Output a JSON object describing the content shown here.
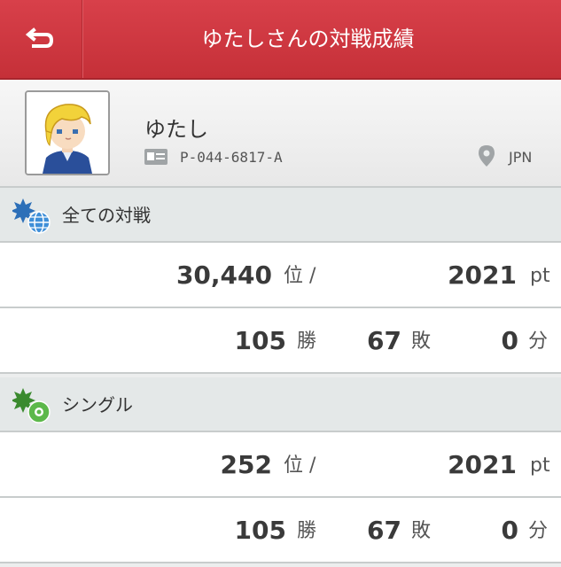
{
  "header": {
    "title": "ゆたしさんの対戦成績",
    "back_icon": "back-arrow-icon"
  },
  "profile": {
    "name": "ゆたし",
    "player_id": "P-044-6817-A",
    "region": "JPN"
  },
  "sections": [
    {
      "label": "全ての対戦",
      "icon": "globe-burst-icon",
      "rank": "30,440",
      "rank_unit": "位 /",
      "rating": "2021",
      "rating_unit": "pt",
      "wins": "105",
      "wins_unit": "勝",
      "losses": "67",
      "losses_unit": "敗",
      "draws": "0",
      "draws_unit": "分"
    },
    {
      "label": "シングル",
      "icon": "single-battle-icon",
      "rank": "252",
      "rank_unit": "位 /",
      "rating": "2021",
      "rating_unit": "pt",
      "wins": "105",
      "wins_unit": "勝",
      "losses": "67",
      "losses_unit": "敗",
      "draws": "0",
      "draws_unit": "分"
    }
  ],
  "colors": {
    "header": "#c8323b",
    "section_bg": "#e4e8e8",
    "divider": "#c8cccc"
  }
}
